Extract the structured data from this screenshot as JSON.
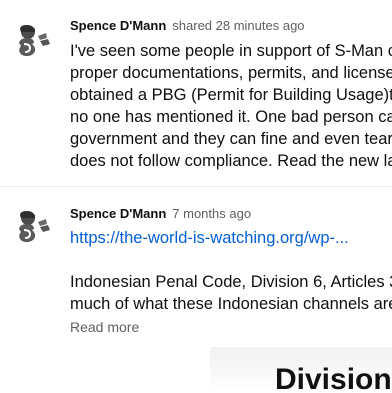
{
  "comments": [
    {
      "author": "Spence D'Mann",
      "timestamp": "shared 28 minutes ago",
      "avatar_icon": "silhouette-person-icon",
      "lines": [
        "I've seen some people in support of S-Man cla",
        "proper documentations, permits, and licenses",
        "obtained a PBG (Permit for Building Usage)to",
        "no one has mentioned it. One bad person can",
        "government and they can fine and even tear d",
        "does not follow compliance. Read the new lav"
      ]
    },
    {
      "author": "Spence D'Mann",
      "timestamp": "7 months ago",
      "avatar_icon": "silhouette-person-icon",
      "link": "https://the-world-is-watching.org/wp-...",
      "lines": [
        "Indonesian Penal Code, Division 6, Articles 33",
        "much of what these Indonesian channels are"
      ],
      "read_more": "Read more",
      "image_heading": "Division S"
    }
  ],
  "colors": {
    "link": "#065fd4",
    "secondary_text": "#606060",
    "primary_text": "#0f0f0f"
  }
}
